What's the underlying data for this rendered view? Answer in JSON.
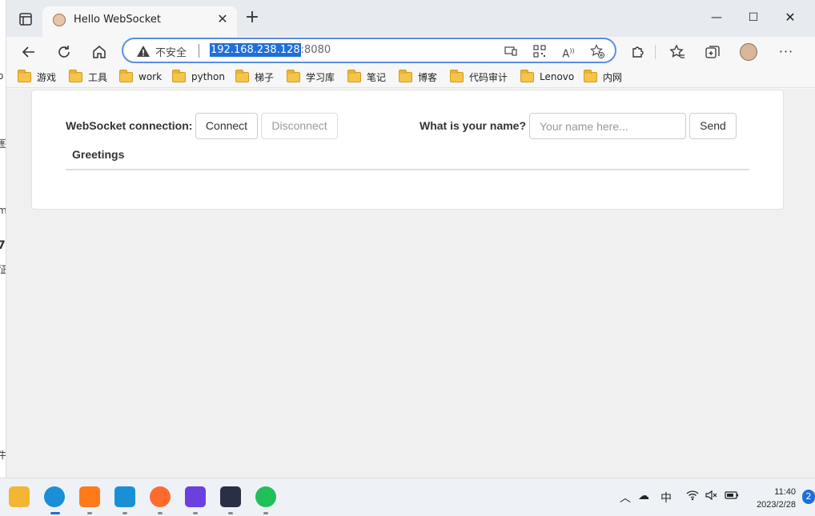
{
  "background_window": {
    "fragments": [
      "o",
      "图",
      "m",
      "7",
      "征",
      "牛"
    ]
  },
  "tab": {
    "title": "Hello WebSocket",
    "close_glyph": "✕"
  },
  "new_tab_glyph": "+",
  "window_controls": {
    "minimize": "—",
    "maximize": "☐",
    "close": "✕"
  },
  "address_bar": {
    "security_label": "不安全",
    "url_host": "192.168.238.128",
    "url_port": ":8080"
  },
  "bookmarks": [
    {
      "label": "游戏"
    },
    {
      "label": "工具"
    },
    {
      "label": "work"
    },
    {
      "label": "python"
    },
    {
      "label": "梯子"
    },
    {
      "label": "学习库"
    },
    {
      "label": "笔记"
    },
    {
      "label": "博客"
    },
    {
      "label": "代码审计"
    },
    {
      "label": "Lenovo"
    },
    {
      "label": "内网"
    }
  ],
  "page": {
    "connection_label": "WebSocket connection:",
    "connect_button": "Connect",
    "disconnect_button": "Disconnect",
    "name_label": "What is your name?",
    "name_placeholder": "Your name here...",
    "send_button": "Send",
    "greetings_header": "Greetings"
  },
  "taskbar": {
    "apps": [
      {
        "name": "file-explorer",
        "color": "#f2b632"
      },
      {
        "name": "edge",
        "color": "#1a8fd8"
      },
      {
        "name": "app-w",
        "color": "#ff7a1a"
      },
      {
        "name": "vmware",
        "color": "#1b8fd6"
      },
      {
        "name": "firefox",
        "color": "#ff6b2c"
      },
      {
        "name": "app-bolt",
        "color": "#6b3fe0"
      },
      {
        "name": "app-cat",
        "color": "#2a2f45"
      },
      {
        "name": "wechat",
        "color": "#1fc05a"
      }
    ],
    "ime": "中",
    "time": "11:40",
    "date": "2023/2/28",
    "notification_count": "2"
  }
}
